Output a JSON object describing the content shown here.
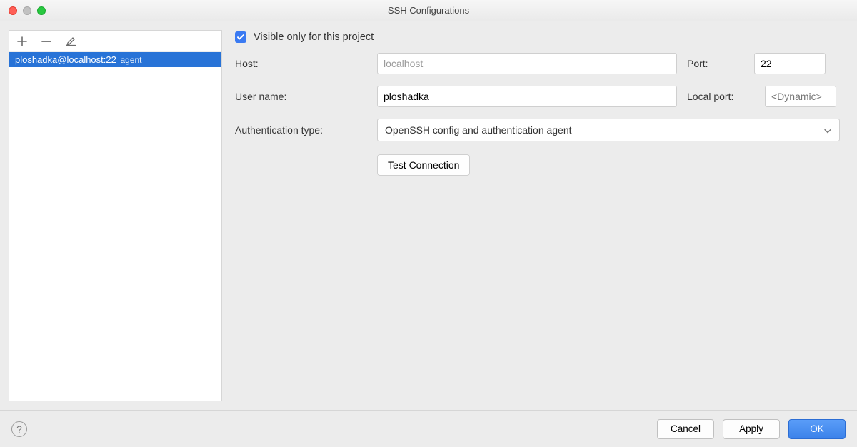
{
  "window": {
    "title": "SSH Configurations"
  },
  "sidebar": {
    "items": [
      {
        "label": "ploshadka@localhost:22",
        "suffix": "agent"
      }
    ]
  },
  "form": {
    "visible_only_label": "Visible only for this project",
    "visible_only_checked": true,
    "host_label": "Host:",
    "host_value": "localhost",
    "port_label": "Port:",
    "port_value": "22",
    "user_label": "User name:",
    "user_value": "ploshadka",
    "local_port_label": "Local port:",
    "local_port_placeholder": "<Dynamic>",
    "auth_type_label": "Authentication type:",
    "auth_type_value": "OpenSSH config and authentication agent",
    "test_button": "Test Connection"
  },
  "footer": {
    "cancel": "Cancel",
    "apply": "Apply",
    "ok": "OK"
  }
}
